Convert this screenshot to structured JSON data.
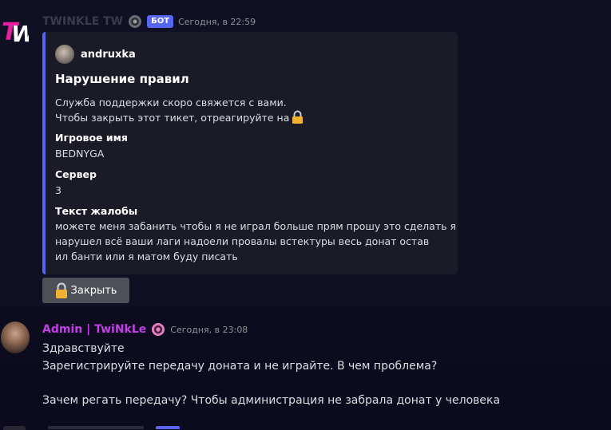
{
  "message1": {
    "bot_name": "TWINKLE TW",
    "bot_tag": "БОТ",
    "timestamp": "Сегодня, в 22:59",
    "embed": {
      "author": "andruxka",
      "title": "Нарушение правил",
      "desc_line1": "Служба поддержки скоро свяжется с вами.",
      "desc_line2": "Чтобы закрыть этот тикет, отреагируйте на",
      "fields": [
        {
          "name": "Игровое имя",
          "value": "BEDNYGA"
        },
        {
          "name": "Сервер",
          "value": "3"
        },
        {
          "name": "Текст жалобы",
          "value": "можете меня забанить чтобы я не играл больше прям прошу это сделать я\nнарушел всё ваши лаги надоели провалы встектуры весь донат остав\nил банти или я матом буду писать"
        }
      ]
    },
    "close_button_label": "Закрыть"
  },
  "message2": {
    "author": "Admin | TwiNkLe",
    "timestamp": "Сегодня, в 23:08",
    "line1": "Здравствуйте",
    "line2": "Зарегистрируйте передачу доната и не играйте. В чем проблема?",
    "line3": "Зачем регать передачу? Чтобы администрация не забрала донат у человека"
  },
  "colors": {
    "accent": "#5865f2",
    "admin_name": "#c43ee8",
    "lock": "#f0b232"
  },
  "icons": {
    "bot_logo": "tw-logo-icon",
    "lock": "lock-icon",
    "gear": "gear-icon",
    "role": "role-badge-icon"
  }
}
